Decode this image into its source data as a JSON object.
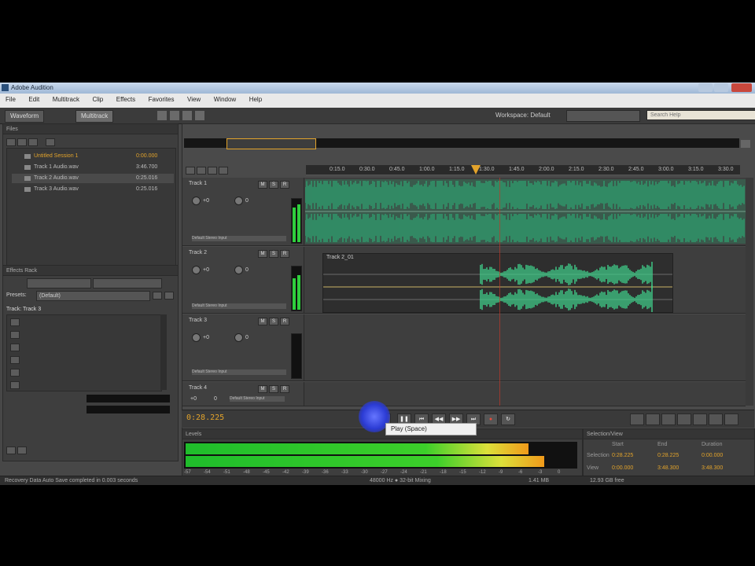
{
  "window": {
    "title": "Adobe Audition"
  },
  "menu": [
    "File",
    "Edit",
    "Multitrack",
    "Clip",
    "Effects",
    "Favorites",
    "View",
    "Window",
    "Help"
  ],
  "workspace": {
    "waveform_tab": "Waveform",
    "multitrack_tab": "Multitrack",
    "workspace_label": "Workspace: Default",
    "search_placeholder": "Search Help"
  },
  "files_panel": {
    "title": "Files",
    "files": [
      {
        "name": "Untitled Session 1",
        "duration": "0:00.000"
      },
      {
        "name": "Track 1 Audio.wav",
        "duration": "3:46.700"
      },
      {
        "name": "Track 2 Audio.wav",
        "duration": "0:25.016"
      },
      {
        "name": "Track 3 Audio.wav",
        "duration": "0:25.016"
      }
    ]
  },
  "effects_panel": {
    "title": "Effects Rack",
    "track_label": "Track: Track 3",
    "presets_label": "Presets:",
    "preset_value": "(Default)"
  },
  "editor": {
    "ruler_ticks": [
      "0:15.0",
      "0:30.0",
      "0:45.0",
      "1:00.0",
      "1:15.0",
      "1:30.0",
      "1:45.0",
      "2:00.0",
      "2:15.0",
      "2:30.0",
      "2:45.0",
      "3:00.0",
      "3:15.0",
      "3:30.0"
    ],
    "tracks": [
      {
        "name": "Track 1",
        "volume": "+0",
        "pan": "0",
        "output": "Default Stereo Input"
      },
      {
        "name": "Track 2",
        "volume": "+0",
        "pan": "0",
        "output": "Default Stereo Input"
      },
      {
        "name": "Track 3",
        "volume": "+0",
        "pan": "0",
        "output": "Default Stereo Input"
      },
      {
        "name": "Track 4",
        "volume": "+0",
        "pan": "0",
        "output": "Default Stereo Input"
      }
    ],
    "clip2_label": "Track 2_01",
    "time_display": "0:28.225"
  },
  "transport": {
    "buttons": [
      "stop",
      "play",
      "pause",
      "move-to-previous",
      "rewind",
      "fast-forward",
      "move-to-next",
      "record"
    ],
    "tooltip": "Play (Space)"
  },
  "levels": {
    "title": "Levels",
    "scale": [
      "-57",
      "-54",
      "-51",
      "-48",
      "-45",
      "-42",
      "-39",
      "-36",
      "-33",
      "-30",
      "-27",
      "-24",
      "-21",
      "-18",
      "-15",
      "-12",
      "-9",
      "-6",
      "-3",
      "0"
    ],
    "left_level": 0.88,
    "right_level": 0.92
  },
  "selection": {
    "title": "Selection/View",
    "headers": [
      "Start",
      "End",
      "Duration"
    ],
    "rows": [
      {
        "label": "Selection",
        "start": "0:28.225",
        "end": "0:28.225",
        "duration": "0:00.000"
      },
      {
        "label": "View",
        "start": "0:00.000",
        "end": "3:48.300",
        "duration": "3:48.300"
      }
    ]
  },
  "status": {
    "left": "Recovery Data Auto Save completed in 0.003 seconds",
    "center": "48000 Hz ● 32-bit Mixing",
    "right1": "1.41 MB",
    "right2": "12.93 GB free"
  },
  "colors": {
    "waveform": "#3fcf8a",
    "track1_wave": "#2e9e6e",
    "meter_green": "#2fcf3d",
    "accent_orange": "#e2a32b",
    "playhead": "#c0392b"
  }
}
